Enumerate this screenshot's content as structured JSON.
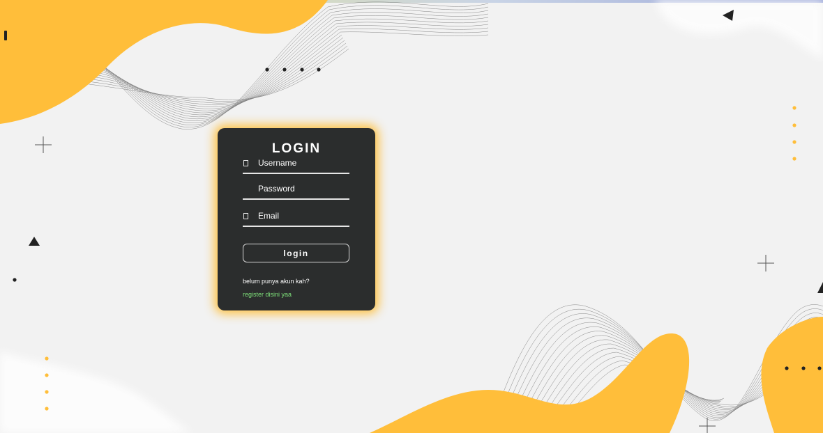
{
  "login_card": {
    "title": "LOGIN",
    "fields": [
      {
        "name": "username",
        "placeholder": "Username",
        "value": "",
        "icon": "user-icon"
      },
      {
        "name": "password",
        "placeholder": "Password",
        "value": "",
        "icon": "lock-icon"
      },
      {
        "name": "email",
        "placeholder": "Email",
        "value": "",
        "icon": "envelope-icon"
      }
    ],
    "submit_label": "login",
    "register_prompt": "belum punya akun kah?",
    "register_link": "register disini yaa"
  },
  "colors": {
    "accent": "#ffbe3a",
    "card_bg": "#2b2d2d",
    "link": "#7ee07a",
    "page_bg": "#f2f2f2"
  }
}
